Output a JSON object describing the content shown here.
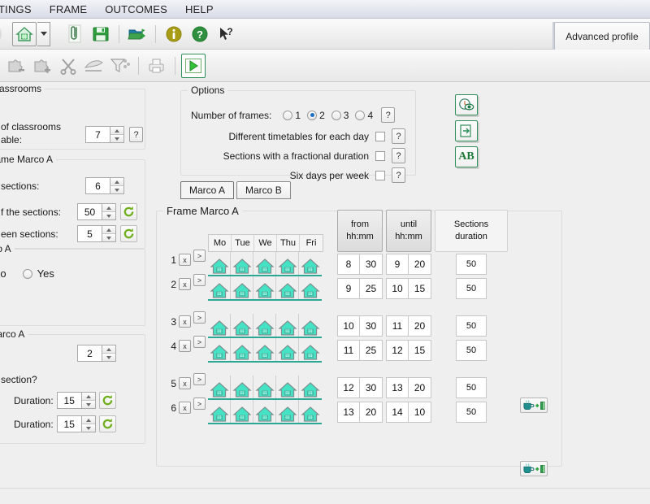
{
  "menubar": {
    "items": [
      {
        "label": "TINGS",
        "name": "menu-settings"
      },
      {
        "label": "FRAME",
        "name": "menu-frame"
      },
      {
        "label": "OUTCOMES",
        "name": "menu-outcomes"
      },
      {
        "label": "HELP",
        "name": "menu-help"
      }
    ]
  },
  "toolbar": {
    "advanced_profile_tab": "Advanced profile",
    "buttons": [
      {
        "name": "home-button",
        "icon": "house-icon"
      },
      {
        "name": "home-dropdown-button",
        "icon": "chevron-down-icon"
      },
      {
        "name": "attach-button",
        "icon": "paperclip-icon"
      },
      {
        "name": "save-button",
        "icon": "floppy-disk-icon"
      },
      {
        "name": "export-button",
        "icon": "export-folder-icon"
      },
      {
        "name": "info-button",
        "icon": "info-icon"
      },
      {
        "name": "help-button",
        "icon": "question-icon"
      },
      {
        "name": "context-help-button",
        "icon": "arrow-question-icon"
      }
    ],
    "buttons2": [
      {
        "name": "remove-item-button",
        "icon": "puzzle-minus-icon"
      },
      {
        "name": "add-item-button",
        "icon": "puzzle-plus-icon"
      },
      {
        "name": "cut-button",
        "icon": "scissors-icon"
      },
      {
        "name": "hand-button",
        "icon": "hand-icon"
      },
      {
        "name": "filter-button",
        "icon": "funnel-icon"
      },
      {
        "name": "print-button",
        "icon": "printer-icon"
      },
      {
        "name": "run-button",
        "icon": "play-icon"
      }
    ]
  },
  "options": {
    "title": "Options",
    "number_of_frames": {
      "label": "Number of frames:",
      "options": [
        "1",
        "2",
        "3",
        "4"
      ],
      "selected": "2"
    },
    "checkboxes": [
      {
        "label": "Different timetables for each day",
        "checked": false
      },
      {
        "label": "Sections with a fractional duration",
        "checked": false
      },
      {
        "label": "Six days per week",
        "checked": false
      }
    ],
    "help_label": "?"
  },
  "sidebar": {
    "classrooms_group": {
      "title": "of classrooms",
      "field_label_line1": "of classrooms",
      "field_label_line2": "able:",
      "value": "7",
      "help_label": "?"
    },
    "timeframe_group": {
      "title": "e frame Marco A",
      "rows": [
        {
          "label": "sections:",
          "value": "6",
          "has_refresh": false
        },
        {
          "label": "f the sections:",
          "value": "50",
          "has_refresh": true
        },
        {
          "label": "een sections:",
          "value": "5",
          "has_refresh": true
        }
      ]
    },
    "marco_a_group": {
      "title": "larco A",
      "radios": [
        {
          "label": "No",
          "selected": true
        },
        {
          "label": "Yes",
          "selected": false
        }
      ]
    },
    "breaks_group": {
      "title": "s Marco A",
      "count_value": "2",
      "question_label": "section?",
      "rows": [
        {
          "duration_label": "Duration:",
          "value": "15"
        },
        {
          "duration_label": "Duration:",
          "value": "15"
        }
      ]
    }
  },
  "side_buttons": [
    {
      "name": "preview-timetable-button",
      "icon": "clock-eye-icon"
    },
    {
      "name": "export-page-button",
      "icon": "page-export-icon"
    },
    {
      "name": "ab-button",
      "icon": "ab-text-icon",
      "label": "AB"
    }
  ],
  "frame": {
    "tabs": [
      {
        "label": "Marco A",
        "active": true
      },
      {
        "label": "Marco B",
        "active": false
      }
    ],
    "group_title": "Frame Marco A",
    "day_headers": [
      "Mo",
      "Tue",
      "We",
      "Thu",
      "Fri"
    ],
    "column_headers": [
      {
        "line1": "from",
        "line2": "hh:mm",
        "style": "shaded"
      },
      {
        "line1": "until",
        "line2": "hh:mm",
        "style": "shaded"
      },
      {
        "line1": "Sections",
        "line2": "duration",
        "style": "plain"
      }
    ],
    "row_delete_label": "x",
    "row_expand_label": ">",
    "blocks": [
      {
        "rows": [
          {
            "num": "1",
            "from_h": "8",
            "from_m": "30",
            "until_h": "9",
            "until_m": "20",
            "duration": "50"
          },
          {
            "num": "2",
            "from_h": "9",
            "from_m": "25",
            "until_h": "10",
            "until_m": "15",
            "duration": "50"
          }
        ],
        "break_after": true
      },
      {
        "rows": [
          {
            "num": "3",
            "from_h": "10",
            "from_m": "30",
            "until_h": "11",
            "until_m": "20",
            "duration": "50"
          },
          {
            "num": "4",
            "from_h": "11",
            "from_m": "25",
            "until_h": "12",
            "until_m": "15",
            "duration": "50"
          }
        ],
        "break_after": true
      },
      {
        "rows": [
          {
            "num": "5",
            "from_h": "12",
            "from_m": "30",
            "until_h": "13",
            "until_m": "20",
            "duration": "50"
          },
          {
            "num": "6",
            "from_h": "13",
            "from_m": "20",
            "until_h": "14",
            "until_m": "10",
            "duration": "50"
          }
        ],
        "break_after": false
      }
    ],
    "break_icon": "coffee-break-icon"
  },
  "colors": {
    "house_fill": "#45e3c6",
    "house_outline": "#7a7a7a",
    "accent_green": "#2f8f5b",
    "radio_dot": "#1a6fc4",
    "menubar_bg": "#e4e7ef",
    "window_bg": "#efefef"
  }
}
